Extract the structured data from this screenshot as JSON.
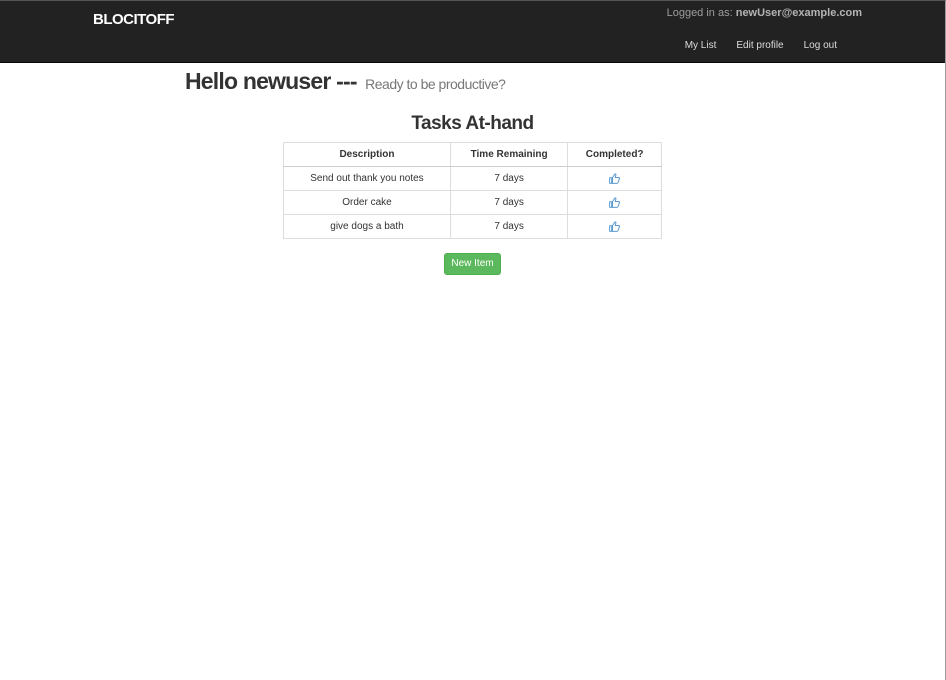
{
  "navbar": {
    "brand": "BLOCITOFF",
    "logged_in_prefix": "Logged in as:",
    "logged_in_email": "newUser@example.com",
    "links": [
      "My List",
      "Edit profile",
      "Log out"
    ]
  },
  "greeting": {
    "hello": "Hello newuser ---",
    "subtitle": "Ready to be productive?"
  },
  "tasks": {
    "title": "Tasks At-hand",
    "columns": [
      "Description",
      "Time Remaining",
      "Completed?"
    ],
    "rows": [
      {
        "description": "Send out thank you notes",
        "time_remaining": "7 days",
        "completed_icon": "thumbs-up-icon"
      },
      {
        "description": "Order cake",
        "time_remaining": "7 days",
        "completed_icon": "thumbs-up-icon"
      },
      {
        "description": "give dogs a bath",
        "time_remaining": "7 days",
        "completed_icon": "thumbs-up-icon"
      }
    ]
  },
  "actions": {
    "new_item_label": "New Item"
  },
  "colors": {
    "navbar_bg": "#222222",
    "button_green": "#5cb85c",
    "icon_blue": "#428bca"
  }
}
